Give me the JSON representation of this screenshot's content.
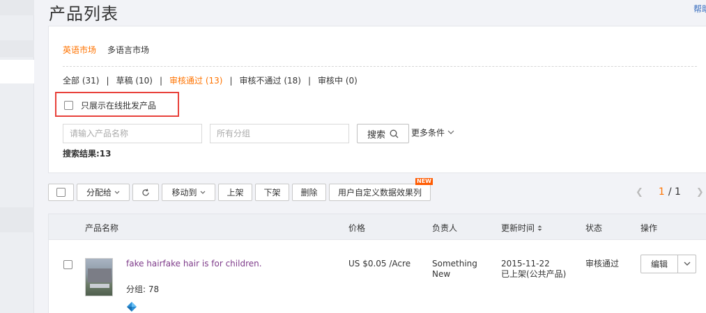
{
  "header": {
    "title": "产品列表",
    "help": "帮助"
  },
  "market_tabs": [
    "英语市场",
    "多语言市场"
  ],
  "status_filters": [
    {
      "label": "全部 (31)"
    },
    {
      "label": "草稿 (10)"
    },
    {
      "label": "审核通过 (13)"
    },
    {
      "label": "审核不通过 (18)"
    },
    {
      "label": "审核中 (0)"
    }
  ],
  "only_online_wholesale": "只展示在线批发产品",
  "search": {
    "name_placeholder": "请输入产品名称",
    "group_placeholder": "所有分组",
    "button": "搜索",
    "more": "更多条件",
    "result": "搜索结果:13"
  },
  "toolbar": {
    "assign": "分配给",
    "move_to": "移动到",
    "list_up": "上架",
    "list_down": "下架",
    "delete": "删除",
    "custom_columns": "用户自定义数据效果列",
    "new_badge": "NEW"
  },
  "pager": {
    "current": "1",
    "total": "/ 1"
  },
  "table": {
    "columns": [
      "产品名称",
      "价格",
      "负责人",
      "更新时间",
      "状态",
      "操作"
    ],
    "rows": [
      {
        "title": "fake hairfake hair is for children.",
        "group": "分组: 78",
        "price": "US $0.05 /Acre",
        "owner_line1": "Something",
        "owner_line2": "New",
        "date": "2015-11-22",
        "date_note": "已上架(公共产品)",
        "status": "审核通过",
        "edit": "编辑"
      }
    ]
  },
  "colors": {
    "accent": "#ff7300",
    "link": "#7e3b8a",
    "highlight_border": "#e8413a"
  }
}
